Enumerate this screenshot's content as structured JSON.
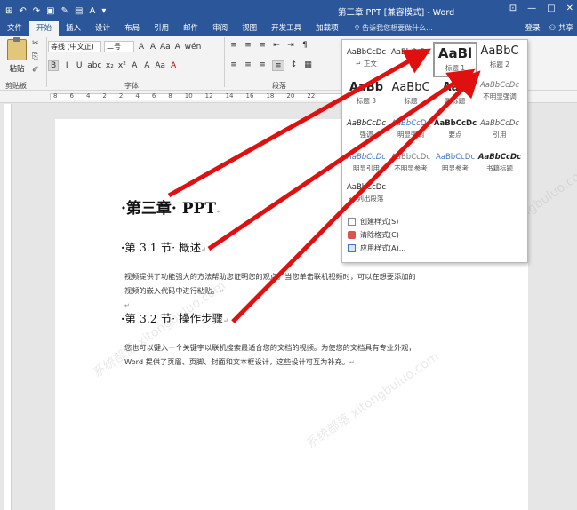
{
  "window": {
    "title": "第三章 PPT [兼容模式] - Word",
    "controls": [
      "⊡",
      "—",
      "□",
      "✕"
    ]
  },
  "qat": [
    "⊞",
    "↶",
    "↷",
    "▣",
    "✎",
    "▤",
    "A",
    "▾"
  ],
  "tabs": [
    "文件",
    "开始",
    "插入",
    "设计",
    "布局",
    "引用",
    "邮件",
    "审阅",
    "视图",
    "开发工具",
    "加载项"
  ],
  "active_tab": "开始",
  "tell_me": "告诉我您想要做什么...",
  "right_links": {
    "login": "登录",
    "share": "共享"
  },
  "ribbon": {
    "paste_label": "粘贴",
    "clipboard_label": "剪贴板",
    "font_label": "字体",
    "paragraph_label": "段落",
    "font_name": "等线 (中文正)",
    "font_size": "二号",
    "font_buttons": [
      "B",
      "I",
      "U",
      "abc",
      "x₂",
      "x²",
      "A",
      "A",
      "Aa",
      "A"
    ],
    "font_row1_buttons": [
      "A",
      "A",
      "Aa",
      "A",
      "wén"
    ],
    "para_row1": [
      "≡",
      "≡",
      "≡",
      "⇤",
      "⇥",
      "¶"
    ],
    "para_row2": [
      "≡",
      "≡",
      "≡",
      "≡",
      "↕",
      "▦"
    ]
  },
  "ruler": {
    "numbers": [
      "8",
      "6",
      "4",
      "2",
      "2",
      "4",
      "6",
      "8",
      "10",
      "12",
      "14",
      "16",
      "18",
      "20",
      "22"
    ]
  },
  "document": {
    "heading1": "第三章· PPT",
    "heading2_a": "第 3.1 节· 概述",
    "para1_line1": "视频提供了功能强大的方法帮助您证明您的观点。当您单击联机视频时，可以在想要添加的",
    "para1_line2": "视频的嵌入代码中进行粘贴。",
    "heading2_b": "第 3.2 节· 操作步骤",
    "para2_line1": "您也可以键入一个关键字以联机搜索最适合您的文档的视频。为使您的文档具有专业外观，",
    "para2_line2": "Word  提供了页眉、页脚、封面和文本框设计，这些设计可互为补充。"
  },
  "styles_gallery": {
    "items": [
      {
        "preview": "AaBbCcDc",
        "name": "↵ 正文"
      },
      {
        "preview": "AaBbCcDc",
        "name": ""
      },
      {
        "preview": "AaBl",
        "name": "标题 1"
      },
      {
        "preview": "AaBbC",
        "name": "标题 2"
      },
      {
        "preview": "AaBb",
        "name": "标题 3"
      },
      {
        "preview": "AaBbC",
        "name": "标题"
      },
      {
        "preview": "AaB",
        "name": "副标题"
      },
      {
        "preview": "AaBbCcDc",
        "name": "不明显强调"
      },
      {
        "preview": "AaBbCcDc",
        "name": "强调"
      },
      {
        "preview": "AaBbCcDc",
        "name": "明显强调"
      },
      {
        "preview": "AaBbCcDc",
        "name": "要点"
      },
      {
        "preview": "AaBbCcDc",
        "name": "引用"
      },
      {
        "preview": "AaBbCcDc",
        "name": "明显引用"
      },
      {
        "preview": "AaBbCcDc",
        "name": "不明显参考"
      },
      {
        "preview": "AaBbCcDc",
        "name": "明显参考"
      },
      {
        "preview": "AaBbCcDc",
        "name": "书籍标题"
      },
      {
        "preview": "AaBbCcDc",
        "name": "↵ 列出段落"
      }
    ],
    "menu": [
      {
        "label": "创建样式(S)"
      },
      {
        "label": "清除格式(C)"
      },
      {
        "label": "应用样式(A)..."
      }
    ]
  },
  "watermark": "系统部落 xitongbuluo.com",
  "colors": {
    "title_bar": "#2b579a",
    "arrow": "#e01010"
  }
}
